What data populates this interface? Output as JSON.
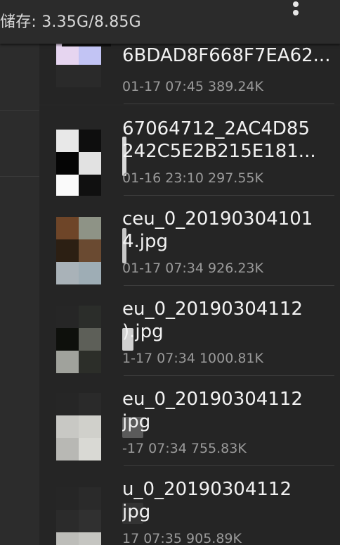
{
  "header": {
    "storage_text": "储存: 3.35G/8.85G"
  },
  "files": [
    {
      "name1": "6BDAD8F668F7EA62...",
      "name2": "",
      "meta": "01-17 07:45  389.24K"
    },
    {
      "name1": "67064712_2AC4D85",
      "name2": "242C5E2B215E181...",
      "meta": "01-16 23:10  297.55K"
    },
    {
      "name1": "ceu_0_20190304101",
      "name2": "4.jpg",
      "meta": "01-17 07:34  926.23K"
    },
    {
      "name1": "eu_0_20190304112",
      "name2": ").jpg",
      "meta": "1-17 07:34  1000.81K"
    },
    {
      "name1": "eu_0_20190304112",
      "name2": "jpg",
      "meta": "-17 07:34  755.83K"
    },
    {
      "name1": "u_0_20190304112",
      "name2": "jpg",
      "meta": "17 07:35  905.89K"
    }
  ]
}
